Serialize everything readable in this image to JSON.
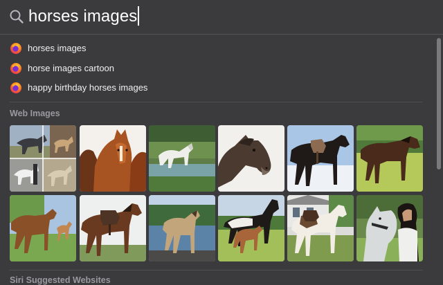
{
  "search": {
    "query": "horses images"
  },
  "suggestions": [
    {
      "label": "horses images",
      "icon": "firefox-icon"
    },
    {
      "label": "horse images cartoon",
      "icon": "firefox-icon"
    },
    {
      "label": "happy birthday horses images",
      "icon": "firefox-icon"
    }
  ],
  "sections": {
    "web_images": "Web Images",
    "siri_websites": "Siri Suggested Websites"
  },
  "images": [
    {
      "subject": "horse-collage"
    },
    {
      "subject": "chestnut-horses"
    },
    {
      "subject": "white-horse-pond"
    },
    {
      "subject": "dark-horse-head"
    },
    {
      "subject": "saddled-black-horse-snow"
    },
    {
      "subject": "bay-horse-field"
    },
    {
      "subject": "mare-and-foal"
    },
    {
      "subject": "saddled-bay-horse"
    },
    {
      "subject": "buckskin-horse-lake"
    },
    {
      "subject": "black-horse-and-foal"
    },
    {
      "subject": "pinto-horse-house"
    },
    {
      "subject": "girl-with-grey-horse"
    }
  ],
  "colors": {
    "background": "#3b3b3d",
    "text": "#f0f0f2",
    "section_title": "#9a9a9e"
  }
}
